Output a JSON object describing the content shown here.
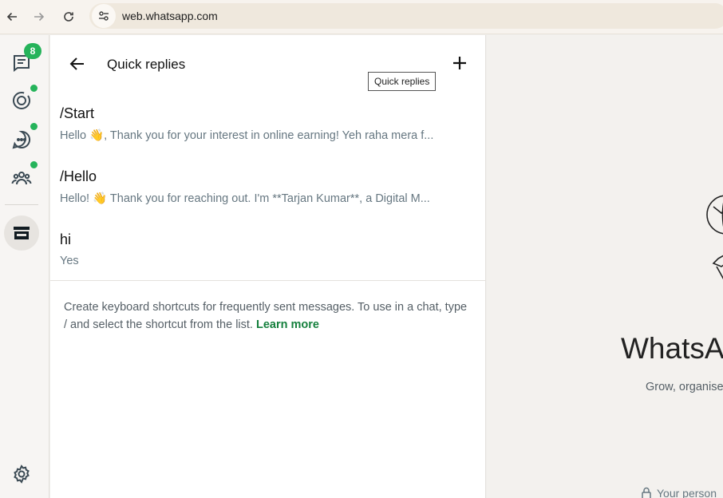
{
  "browser": {
    "url": "web.whatsapp.com",
    "icons": {
      "back": "arrow-left-icon",
      "forward": "arrow-right-icon",
      "reload": "reload-icon",
      "site_settings": "tune-icon"
    }
  },
  "rail": {
    "chats_badge": "8",
    "items": [
      {
        "name": "chats",
        "icon": "chat-list-icon",
        "badge": "8"
      },
      {
        "name": "status",
        "icon": "status-ring-icon",
        "dot": true
      },
      {
        "name": "channels",
        "icon": "channels-icon",
        "dot": true
      },
      {
        "name": "communities",
        "icon": "communities-icon",
        "dot": true
      },
      {
        "name": "tools",
        "icon": "store-icon",
        "active": true
      },
      {
        "name": "settings",
        "icon": "gear-icon"
      }
    ],
    "accent": "#25b35a"
  },
  "panel": {
    "title": "Quick replies",
    "tooltip": "Quick replies",
    "replies": [
      {
        "shortcut": "/Start",
        "message": "Hello 👋, Thank you for your interest in online earning! Yeh raha mera f..."
      },
      {
        "shortcut": "/Hello",
        "message": "Hello! 👋 Thank you for reaching out. I'm **Tarjan Kumar**, a Digital M..."
      },
      {
        "shortcut": "hi",
        "message": "Yes"
      }
    ],
    "help_text": "Create keyboard shortcuts for frequently sent messages. To use in a chat, type / and select the shortcut from the list.",
    "help_link": "Learn more",
    "link_color": "#15803d"
  },
  "intro": {
    "title": "WhatsAp",
    "subtitle": "Grow, organise",
    "footer": "Your person"
  }
}
